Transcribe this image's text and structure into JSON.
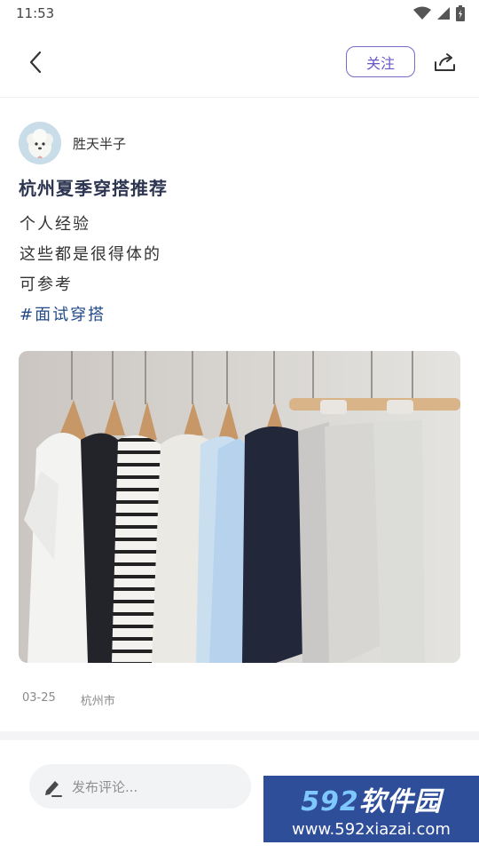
{
  "status_bar": {
    "time": "11:53"
  },
  "header": {
    "follow_label": "关注"
  },
  "author": {
    "name": "胜天半子"
  },
  "post": {
    "title": "杭州夏季穿搭推荐",
    "lines": [
      "个人经验",
      "这些都是很得体的",
      "可参考"
    ],
    "tag": "#面试穿搭",
    "date": "03-25",
    "location": "杭州市"
  },
  "comment": {
    "placeholder": "发布评论..."
  },
  "watermark": {
    "brand_num": "592",
    "brand_text": "软件园",
    "url": "www.592xiazai.com"
  },
  "icons": {
    "back": "chevron-left-icon",
    "share": "share-icon",
    "wifi": "wifi-icon",
    "signal": "signal-icon",
    "battery": "battery-icon",
    "edit": "pencil-icon"
  },
  "colors": {
    "accent": "#6a55c6",
    "tag": "#234a87",
    "title": "#2d3550"
  }
}
